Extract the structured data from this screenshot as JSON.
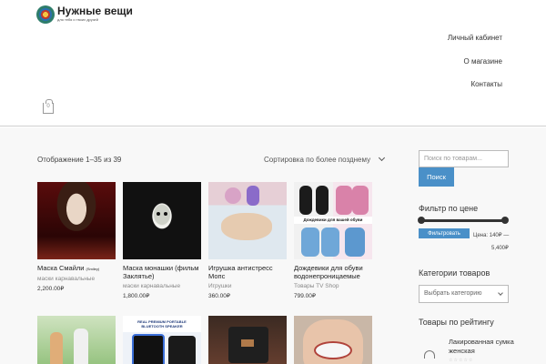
{
  "site": {
    "title": "Нужные вещи",
    "tagline": "для тебя и твоих друзей"
  },
  "nav": {
    "account": "Личный кабинет",
    "about": "О магазине",
    "contacts": "Контакты"
  },
  "cart": {
    "count": "0"
  },
  "shop": {
    "result_count": "Отображение 1–35 из 39",
    "ordering": "Сортировка по более позднему"
  },
  "products": [
    {
      "title": "Маска Смайли",
      "title_note": "(Smiley)",
      "category": "маски карнавальные",
      "price": "2,200.00₽",
      "image": "smiley-mask"
    },
    {
      "title": "Маска монашки (фильм Заклятье)",
      "title_note": "",
      "category": "маски карнавальные",
      "price": "1,800.00₽",
      "image": "nun-mask"
    },
    {
      "title": "Игрушка антистресс Мопс",
      "title_note": "",
      "category": "Игрушки",
      "price": "360.00₽",
      "image": "pug-toy"
    },
    {
      "title": "Дождевики для обуви водонепроницаемые",
      "title_note": "",
      "category": "Товары TV Shop",
      "price": "799.00₽",
      "image": "shoe-covers",
      "image_banner": "Дождевики для вашей обуви"
    },
    {
      "image": "family-park"
    },
    {
      "image": "speaker",
      "image_label": "REAL PREMIUM PORTABLE BLUETOOTH SPEAKER"
    },
    {
      "image": "bag"
    },
    {
      "image": "mouth-stretcher"
    }
  ],
  "sidebar": {
    "search_placeholder": "Поиск по товарам...",
    "search_button": "Поиск",
    "filter_title": "Фильтр по цене",
    "filter_button": "Фильтровать",
    "price_label": "Цена: 140₽ —",
    "price_max": "5,400₽",
    "categories_title": "Категории товаров",
    "category_select": "Выбрать категорию",
    "rating_title": "Товары по рейтингу",
    "rated_product": "Лакированная сумка женская",
    "rated_stars": "☆☆☆☆☆"
  },
  "colors": {
    "accent": "#4a90c8",
    "header_border": "#cfcfcf",
    "main_bg": "#f8f8f8"
  }
}
